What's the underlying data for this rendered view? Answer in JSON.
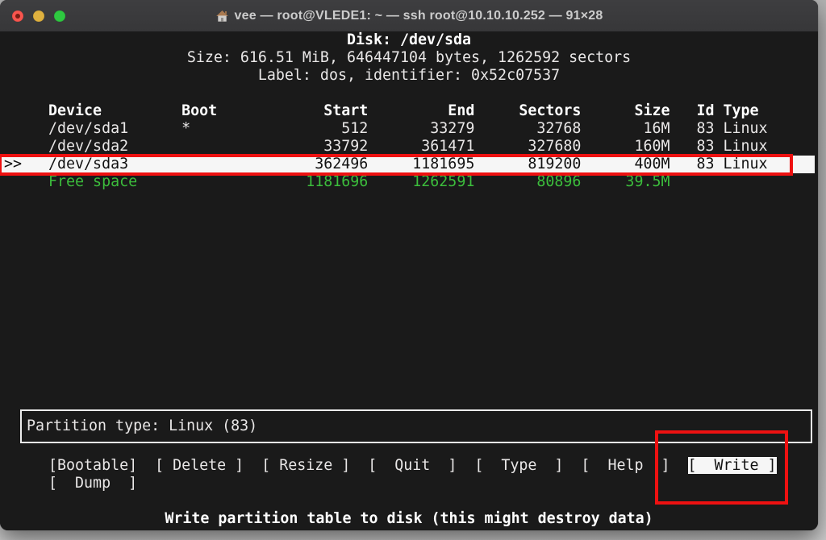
{
  "window": {
    "title": "vee — root@VLEDE1: ~ — ssh root@10.10.10.252 — 91×28",
    "traffic_lights": [
      "close",
      "minimize",
      "zoom"
    ]
  },
  "colors": {
    "terminal_background": "#1a1a1a",
    "terminal_text": "#e9e7e7",
    "free_space_green": "#3cbd3c",
    "selection_bg": "#f6f6f6",
    "annotation_red": "#ee1111",
    "traffic_red": "#f9554e",
    "traffic_yellow": "#dfb13f",
    "traffic_green": "#2ec840"
  },
  "disk_info": {
    "title": "Disk: /dev/sda",
    "size_line": "Size: 616.51 MiB, 646447104 bytes, 1262592 sectors",
    "label_line": "Label: dos, identifier: 0x52c07537"
  },
  "partition_table": {
    "columns": [
      "Device",
      "Boot",
      "Start",
      "End",
      "Sectors",
      "Size",
      "Id",
      "Type"
    ],
    "selection_marker": ">>",
    "rows": [
      {
        "device": "/dev/sda1",
        "boot": "*",
        "start": "512",
        "end": "33279",
        "sectors": "32768",
        "size": "16M",
        "id": "83",
        "type": "Linux",
        "selected": false
      },
      {
        "device": "/dev/sda2",
        "boot": "",
        "start": "33792",
        "end": "361471",
        "sectors": "327680",
        "size": "160M",
        "id": "83",
        "type": "Linux",
        "selected": false
      },
      {
        "device": "/dev/sda3",
        "boot": "",
        "start": "362496",
        "end": "1181695",
        "sectors": "819200",
        "size": "400M",
        "id": "83",
        "type": "Linux",
        "selected": true
      },
      {
        "device": "Free space",
        "boot": "",
        "start": "1181696",
        "end": "1262591",
        "sectors": "80896",
        "size": "39.5M",
        "id": "",
        "type": "",
        "selected": false
      }
    ]
  },
  "partition_type_label": "Partition type: Linux (83)",
  "menu": {
    "row1": [
      {
        "label": "[Bootable]",
        "selected": false
      },
      {
        "label": "[ Delete ]",
        "selected": false
      },
      {
        "label": "[ Resize ]",
        "selected": false
      },
      {
        "label": "[  Quit  ]",
        "selected": false
      },
      {
        "label": "[  Type  ]",
        "selected": false
      },
      {
        "label": "[  Help  ]",
        "selected": false
      },
      {
        "label": "[  Write ]",
        "selected": true
      }
    ],
    "row2": [
      {
        "label": "[  Dump  ]",
        "selected": false
      }
    ]
  },
  "status_line": "Write partition table to disk (this might destroy data)"
}
